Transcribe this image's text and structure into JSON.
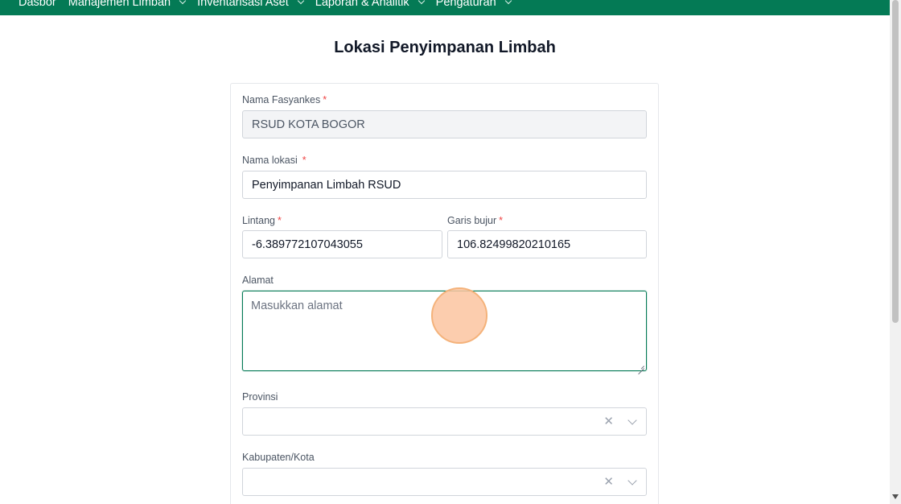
{
  "nav": {
    "items": [
      {
        "label": "Dasbor",
        "has_dropdown": false
      },
      {
        "label": "Manajemen Limbah",
        "has_dropdown": true
      },
      {
        "label": "Inventarisasi Aset",
        "has_dropdown": true
      },
      {
        "label": "Laporan & Analitik",
        "has_dropdown": true
      },
      {
        "label": "Pengaturan",
        "has_dropdown": true
      }
    ]
  },
  "page": {
    "title": "Lokasi Penyimpanan Limbah"
  },
  "form": {
    "required_mark": "*",
    "facility": {
      "label": "Nama Fasyankes",
      "value": "RSUD KOTA BOGOR"
    },
    "location": {
      "label": "Nama lokasi",
      "value": "Penyimpanan Limbah RSUD"
    },
    "latitude": {
      "label": "Lintang",
      "value": "-6.389772107043055"
    },
    "longitude": {
      "label": "Garis bujur",
      "value": "106.82499820210165"
    },
    "address": {
      "label": "Alamat",
      "placeholder": "Masukkan alamat"
    },
    "province": {
      "label": "Provinsi",
      "clear_glyph": "✕"
    },
    "city": {
      "label": "Kabupaten/Kota",
      "clear_glyph": "✕"
    }
  },
  "colors": {
    "brand": "#047a55",
    "required": "#ef4444"
  }
}
